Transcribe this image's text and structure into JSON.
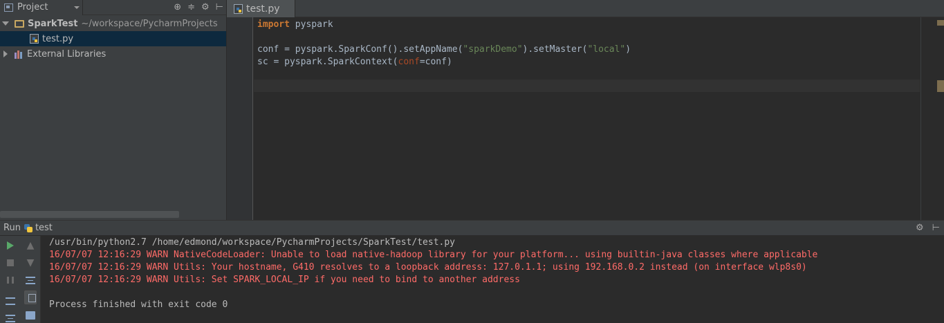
{
  "project_panel": {
    "tab_label": "Project",
    "tools": [
      "⊕",
      "≑",
      "⚙",
      "⊢"
    ],
    "tree": {
      "root": {
        "name": "SparkTest",
        "path": "~/workspace/PycharmProjects"
      },
      "file": "test.py",
      "libraries": "External Libraries"
    }
  },
  "editor": {
    "tab_label": "test.py",
    "lines": {
      "l1_kw": "import",
      "l1_rest": " pyspark",
      "l3_a": "conf = pyspark.SparkConf().setAppName(",
      "l3_s1": "\"sparkDemo\"",
      "l3_b": ").setMaster(",
      "l3_s2": "\"local\"",
      "l3_c": ")",
      "l4_a": "sc = pyspark.SparkContext(",
      "l4_p": "conf",
      "l4_b": "=conf)"
    }
  },
  "run_panel": {
    "label": "Run",
    "config": "test",
    "tools": [
      "⚙",
      "⊢"
    ],
    "console": {
      "command": "/usr/bin/python2.7 /home/edmond/workspace/PycharmProjects/SparkTest/test.py",
      "warnings": [
        "16/07/07 12:16:29 WARN NativeCodeLoader: Unable to load native-hadoop library for your platform... using builtin-java classes where applicable",
        "16/07/07 12:16:29 WARN Utils: Your hostname, G410 resolves to a loopback address: 127.0.1.1; using 192.168.0.2 instead (on interface wlp8s0)",
        "16/07/07 12:16:29 WARN Utils: Set SPARK_LOCAL_IP if you need to bind to another address"
      ],
      "exit": "Process finished with exit code 0"
    }
  },
  "colors": {
    "keyword": "#cc7832",
    "string": "#6a8759",
    "error": "#ff6b68",
    "selection": "#0d293e"
  }
}
